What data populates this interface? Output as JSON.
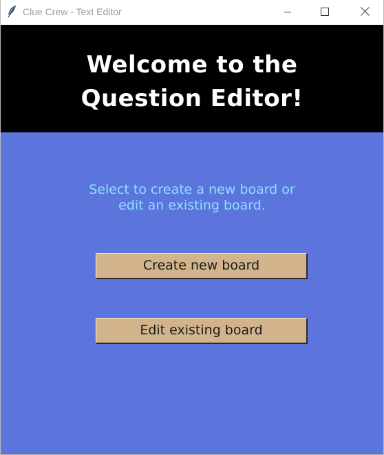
{
  "window": {
    "title": "Clue Crew - Text Editor",
    "icon": "feather-icon",
    "controls": [
      "minimize-icon",
      "maximize-icon",
      "close-icon"
    ]
  },
  "header": {
    "title_line1": "Welcome to the",
    "title_line2": "Question Editor!",
    "background": "#000000",
    "text_color": "#ffffff"
  },
  "main": {
    "background": "#5b75dc",
    "instructions_line1": "Select to create a new board or",
    "instructions_line2": "edit an existing board.",
    "instructions_color": "#8ee0ff",
    "buttons": {
      "create_label": "Create new board",
      "edit_label": "Edit existing board",
      "color": "#d2b48c"
    }
  }
}
